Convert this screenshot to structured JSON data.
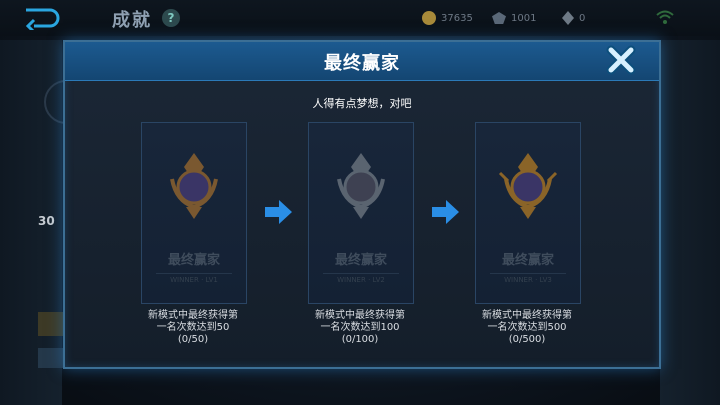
{
  "background": {
    "page_title": "成就",
    "help_symbol": "?",
    "currencies": [
      {
        "icon": "coin-icon",
        "value": "37635"
      },
      {
        "icon": "gem-icon",
        "value": "1001"
      },
      {
        "icon": "diamond-icon",
        "value": "0"
      }
    ],
    "side_score": "30",
    "colors": {
      "frame": "#3c6f95",
      "header": "#1c5a90",
      "accent": "#2a8ee6"
    }
  },
  "modal": {
    "title": "最终赢家",
    "subtitle": "人得有点梦想，对吧",
    "close_icon": "close-x-icon",
    "tiers": [
      {
        "medal": "bronze-medal-icon",
        "name": "最终赢家",
        "name_sub": "WINNER · LV1",
        "desc_line1": "新模式中最终获得第",
        "desc_line2": "一名次数达到50",
        "progress": "(0/50)"
      },
      {
        "medal": "silver-medal-icon",
        "name": "最终赢家",
        "name_sub": "WINNER · LV2",
        "desc_line1": "新模式中最终获得第",
        "desc_line2": "一名次数达到100",
        "progress": "(0/100)"
      },
      {
        "medal": "gold-medal-icon",
        "name": "最终赢家",
        "name_sub": "WINNER · LV3",
        "desc_line1": "新模式中最终获得第",
        "desc_line2": "一名次数达到500",
        "progress": "(0/500)"
      }
    ]
  }
}
